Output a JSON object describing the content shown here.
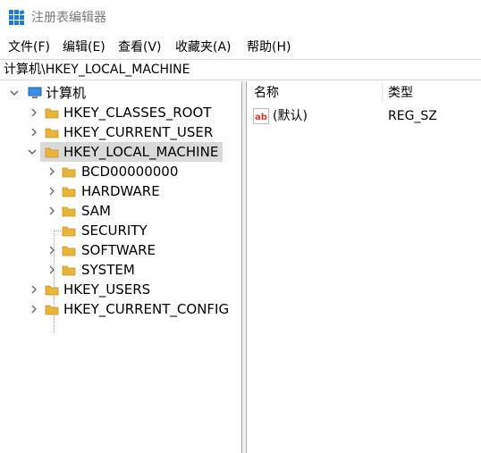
{
  "window": {
    "title": "注册表编辑器"
  },
  "menu": [
    "文件(F)",
    "编辑(E)",
    "查看(V)",
    "收藏夹(A)",
    "帮助(H)"
  ],
  "address": "计算机\\HKEY_LOCAL_MACHINE",
  "tree": {
    "root": "计算机",
    "hives": [
      "HKEY_CLASSES_ROOT",
      "HKEY_CURRENT_USER",
      "HKEY_LOCAL_MACHINE",
      "HKEY_USERS",
      "HKEY_CURRENT_CONFIG"
    ],
    "selected": "HKEY_LOCAL_MACHINE",
    "children": [
      "BCD00000000",
      "HARDWARE",
      "SAM",
      "SECURITY",
      "SOFTWARE",
      "SYSTEM"
    ]
  },
  "list": {
    "columns": [
      "名称",
      "类型"
    ],
    "rows": [
      {
        "name": "(默认)",
        "type": "REG_SZ",
        "icon": "string-value-icon"
      }
    ]
  },
  "colors": {
    "folder": "#e8b43a",
    "selection": "#d9d9d9",
    "app_icon": "#1f7ad6"
  }
}
